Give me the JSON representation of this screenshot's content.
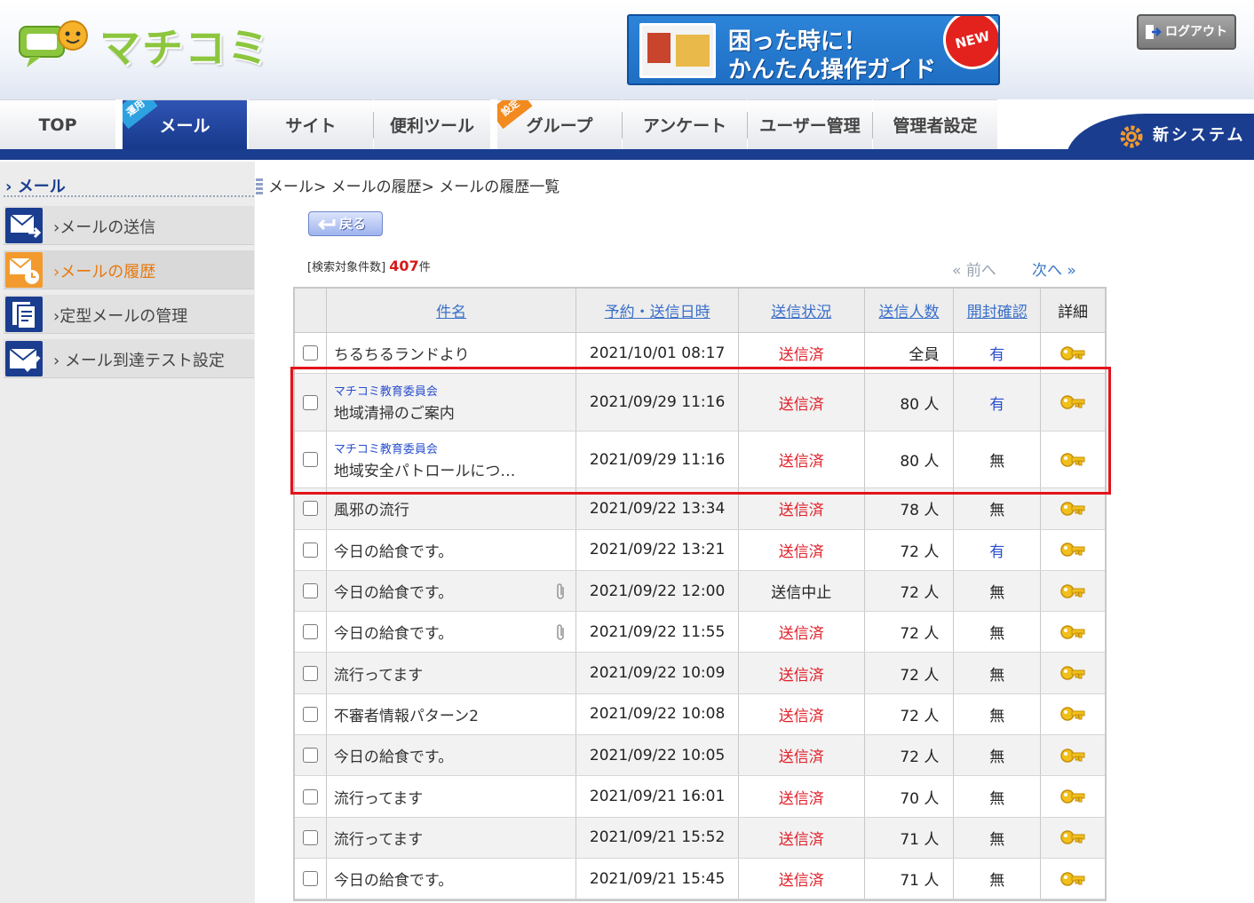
{
  "header": {
    "logo_text": "マチコミ",
    "banner": {
      "line1": "困った時に！",
      "line2": "かんたん操作ガイド",
      "badge": "NEW"
    },
    "logout_label": "ログアウト"
  },
  "nav": {
    "tabs": [
      {
        "label": "TOP",
        "active": false,
        "flag": ""
      },
      {
        "label": "メール",
        "active": true,
        "flag": "運用"
      },
      {
        "label": "サイト",
        "active": false,
        "flag": ""
      },
      {
        "label": "便利ツール",
        "active": false,
        "flag": ""
      },
      {
        "label": "グループ",
        "active": false,
        "flag": "設定"
      },
      {
        "label": "アンケート",
        "active": false,
        "flag": ""
      },
      {
        "label": "ユーザー管理",
        "active": false,
        "flag": ""
      },
      {
        "label": "管理者設定",
        "active": false,
        "flag": ""
      }
    ],
    "new_system_label": "新システム"
  },
  "sidebar": {
    "title": "メール",
    "items": [
      {
        "label": "メールの送信",
        "active": false
      },
      {
        "label": "メールの履歴",
        "active": true
      },
      {
        "label": "定型メールの管理",
        "active": false
      },
      {
        "label": " メール到達テスト設定",
        "active": false
      }
    ]
  },
  "main": {
    "breadcrumb": "メール> メールの履歴> メールの履歴一覧",
    "back_label": "戻る",
    "count_prefix": "[検索対象件数]",
    "count_value": "407",
    "count_suffix": "件",
    "pager_prev": "前へ",
    "pager_next": "次へ"
  },
  "table": {
    "headers": {
      "subject": "件名",
      "date": "予約・送信日時",
      "status": "送信状況",
      "count": "送信人数",
      "open": "開封確認",
      "detail": "詳細"
    },
    "rows": [
      {
        "sender": "",
        "subject": "ちるちるランドより",
        "date": "2021/10/01 08:17",
        "status": "送信済",
        "count": "全員",
        "open": "有",
        "clip": false
      },
      {
        "sender": "マチコミ教育委員会",
        "subject": "地域清掃のご案内",
        "date": "2021/09/29 11:16",
        "status": "送信済",
        "count": "80 人",
        "open": "有",
        "clip": false
      },
      {
        "sender": "マチコミ教育委員会",
        "subject": "地域安全パトロールにつ…",
        "date": "2021/09/29 11:16",
        "status": "送信済",
        "count": "80 人",
        "open": "無",
        "clip": false
      },
      {
        "sender": "",
        "subject": "風邪の流行",
        "date": "2021/09/22 13:34",
        "status": "送信済",
        "count": "78 人",
        "open": "無",
        "clip": false
      },
      {
        "sender": "",
        "subject": "今日の給食です。",
        "date": "2021/09/22 13:21",
        "status": "送信済",
        "count": "72 人",
        "open": "有",
        "clip": false
      },
      {
        "sender": "",
        "subject": "今日の給食です。",
        "date": "2021/09/22 12:00",
        "status": "送信中止",
        "count": "72 人",
        "open": "無",
        "clip": true
      },
      {
        "sender": "",
        "subject": "今日の給食です。",
        "date": "2021/09/22 11:55",
        "status": "送信済",
        "count": "72 人",
        "open": "無",
        "clip": true
      },
      {
        "sender": "",
        "subject": "流行ってます",
        "date": "2021/09/22 10:09",
        "status": "送信済",
        "count": "72 人",
        "open": "無",
        "clip": false
      },
      {
        "sender": "",
        "subject": "不審者情報パターン2",
        "date": "2021/09/22 10:08",
        "status": "送信済",
        "count": "72 人",
        "open": "無",
        "clip": false
      },
      {
        "sender": "",
        "subject": "今日の給食です。",
        "date": "2021/09/22 10:05",
        "status": "送信済",
        "count": "72 人",
        "open": "無",
        "clip": false
      },
      {
        "sender": "",
        "subject": "流行ってます",
        "date": "2021/09/21 16:01",
        "status": "送信済",
        "count": "70 人",
        "open": "無",
        "clip": false
      },
      {
        "sender": "",
        "subject": "流行ってます",
        "date": "2021/09/21 15:52",
        "status": "送信済",
        "count": "71 人",
        "open": "無",
        "clip": false
      },
      {
        "sender": "",
        "subject": "今日の給食です。",
        "date": "2021/09/21 15:45",
        "status": "送信済",
        "count": "71 人",
        "open": "無",
        "clip": false
      }
    ]
  },
  "colors": {
    "nav_blue": "#1a3d8f",
    "sent_red": "#e0202a",
    "link_blue": "#3a6fc9",
    "highlight_red": "#e3131b",
    "sidebar_active_orange": "#e8790f"
  },
  "icons": {
    "logo": "chat-bubble-logo-icon",
    "logout": "exit-door-icon",
    "new_system": "gear-icon",
    "back": "return-arrow-icon",
    "send": "mail-send-icon",
    "history": "mail-history-icon",
    "template": "mail-template-icon",
    "test": "mail-check-icon",
    "attachment": "paperclip-icon",
    "detail": "key-icon"
  }
}
